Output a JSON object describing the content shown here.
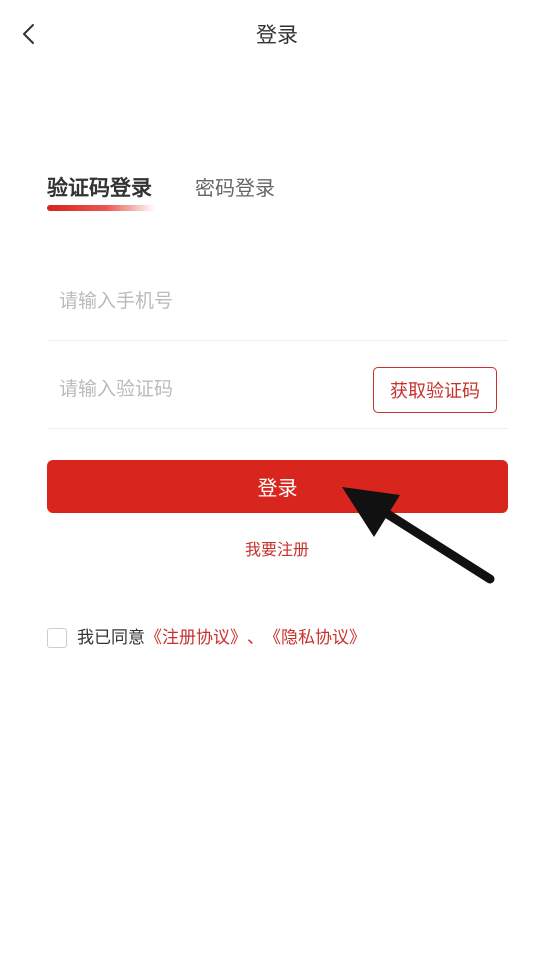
{
  "header": {
    "title": "登录"
  },
  "tabs": [
    {
      "label": "验证码登录",
      "active": true
    },
    {
      "label": "密码登录",
      "active": false
    }
  ],
  "form": {
    "phone_placeholder": "请输入手机号",
    "phone_value": "",
    "code_placeholder": "请输入验证码",
    "code_value": "",
    "get_code_label": "获取验证码",
    "login_label": "登录"
  },
  "register_label": "我要注册",
  "agreement": {
    "checked": false,
    "prefix": "我已同意",
    "link1": "《注册协议》",
    "separator": "、",
    "link2": "《隐私协议》"
  },
  "colors": {
    "accent": "#d8251e",
    "link": "#c9302c"
  },
  "icons": {
    "back": "chevron-left-icon"
  }
}
